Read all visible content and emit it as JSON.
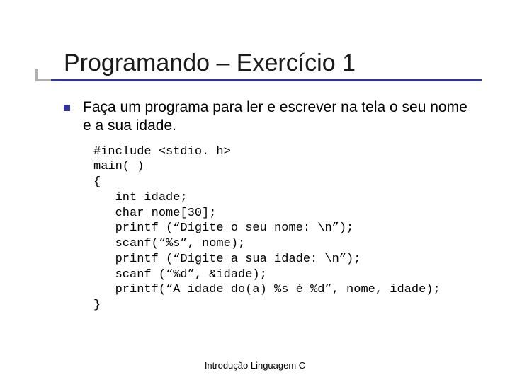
{
  "title": "Programando – Exercício 1",
  "bullet": "Faça um programa para ler e escrever na tela o seu nome e a sua idade.",
  "code": {
    "l1": "#include <stdio. h>",
    "l2": "main( )",
    "l3": "{",
    "l4": "   int idade;",
    "l5": "   char nome[30];",
    "l6": "   printf (“Digite o seu nome: \\n”);",
    "l7": "   scanf(“%s”, nome);",
    "l8": "   printf (“Digite a sua idade: \\n”);",
    "l9": "   scanf (“%d”, &idade);",
    "l10": "   printf(“A idade do(a) %s é %d”, nome, idade);",
    "l11": "}"
  },
  "footer": "Introdução Linguagem C"
}
